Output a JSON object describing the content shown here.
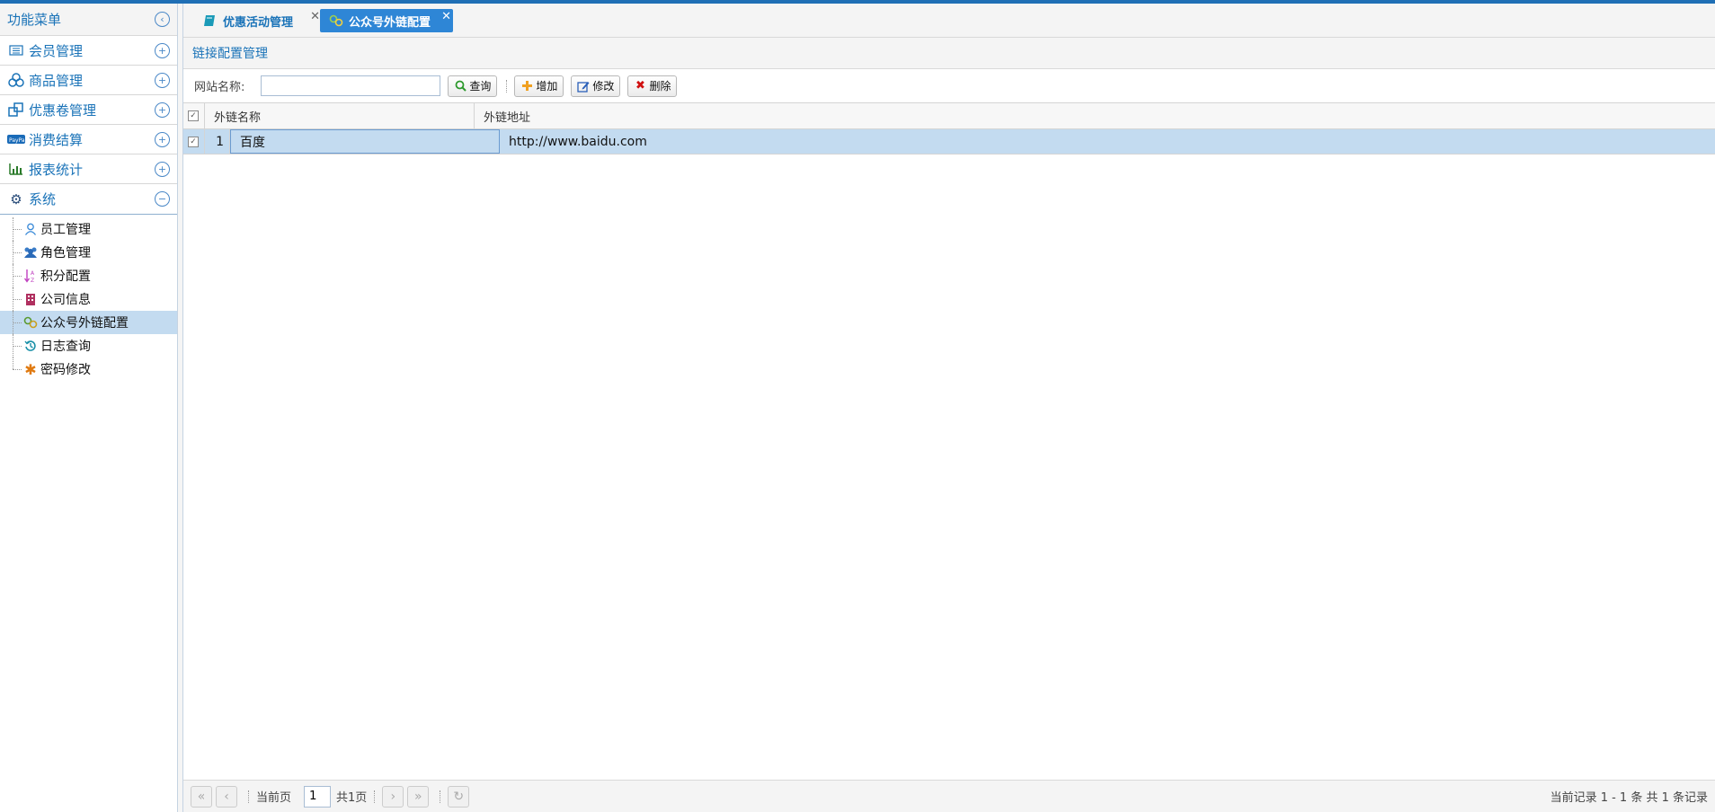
{
  "sidebar": {
    "title": "功能菜单",
    "menus": [
      {
        "label": "会员管理",
        "icon": "member-list-icon"
      },
      {
        "label": "商品管理",
        "icon": "products-icon"
      },
      {
        "label": "优惠卷管理",
        "icon": "coupon-icon"
      },
      {
        "label": "消费结算",
        "icon": "paypal-icon"
      },
      {
        "label": "报表统计",
        "icon": "bar-chart-icon"
      },
      {
        "label": "系统",
        "icon": "gear-icon"
      }
    ],
    "system_items": [
      {
        "label": "员工管理",
        "icon": "user-icon"
      },
      {
        "label": "角色管理",
        "icon": "users-icon"
      },
      {
        "label": "积分配置",
        "icon": "sort-az-icon"
      },
      {
        "label": "公司信息",
        "icon": "building-icon"
      },
      {
        "label": "公众号外链配置",
        "icon": "link-icon"
      },
      {
        "label": "日志查询",
        "icon": "history-icon"
      },
      {
        "label": "密码修改",
        "icon": "asterisk-icon"
      }
    ]
  },
  "tabs": [
    {
      "label": "优惠活动管理",
      "icon": "book-icon"
    },
    {
      "label": "公众号外链配置",
      "icon": "link-icon"
    }
  ],
  "panel": {
    "title": "链接配置管理"
  },
  "toolbar": {
    "site_name_label": "网站名称:",
    "site_name_value": "",
    "query_label": "查询",
    "add_label": "增加",
    "edit_label": "修改",
    "delete_label": "删除"
  },
  "grid": {
    "columns": [
      "外链名称",
      "外链地址"
    ],
    "rows": [
      {
        "index": "1",
        "name": "百度",
        "url": "http://www.baidu.com"
      }
    ]
  },
  "pager": {
    "current_label": "当前页",
    "page": "1",
    "total_label": "共1页",
    "info": "当前记录 1 - 1 条 共 1 条记录"
  },
  "colors": {
    "accent": "#2e86d6",
    "selected_row": "#c3dbf0",
    "topbar": "#1f6fb5"
  }
}
